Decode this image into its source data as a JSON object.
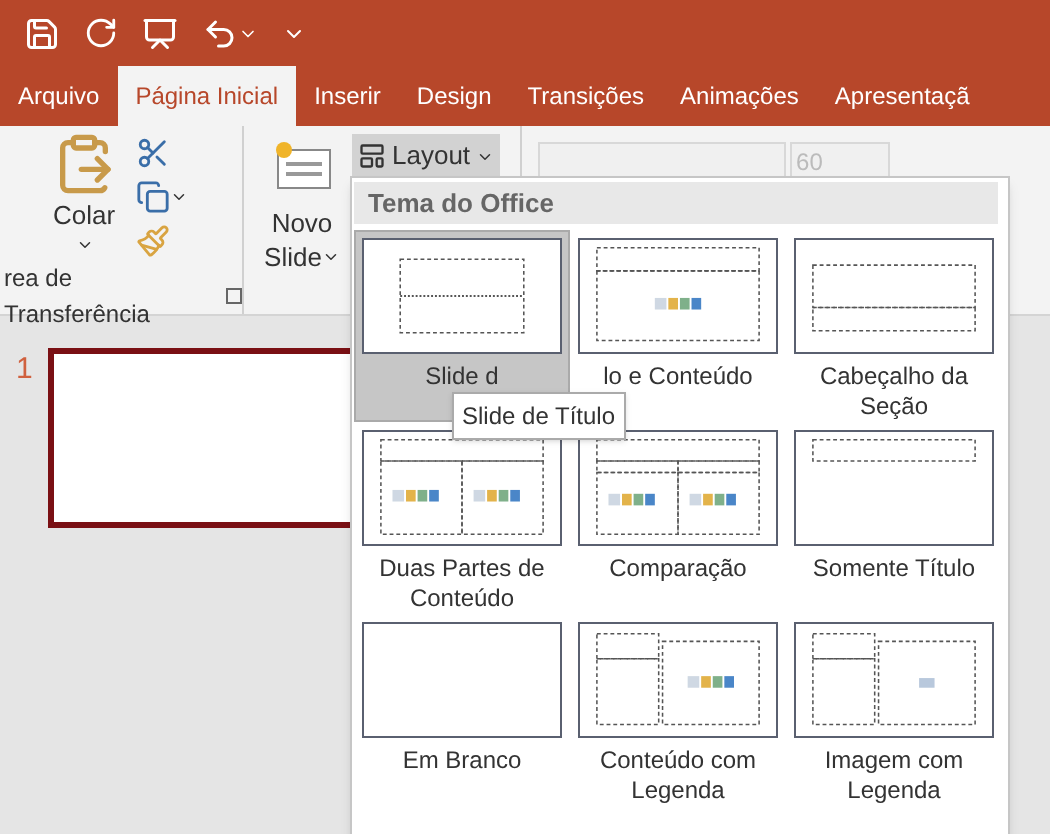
{
  "tabs": [
    {
      "label": "Arquivo",
      "selected": false
    },
    {
      "label": "Página Inicial",
      "selected": true
    },
    {
      "label": "Inserir",
      "selected": false
    },
    {
      "label": "Design",
      "selected": false
    },
    {
      "label": "Transições",
      "selected": false
    },
    {
      "label": "Animações",
      "selected": false
    },
    {
      "label": "Apresentaçã",
      "selected": false
    }
  ],
  "ribbon": {
    "paste_label": "Colar",
    "clipboard_group_label": "rea de Transferência",
    "new_slide_label": "Novo",
    "new_slide_label_2": "Slide",
    "layout_button": {
      "label": "Layout",
      "pressed": true
    },
    "font_size": "60"
  },
  "slides": [
    {
      "number": "1",
      "selected": true
    }
  ],
  "layout_menu": {
    "header": "Tema do Office",
    "tooltip": "Slide de Título",
    "items": [
      {
        "label": "Slide d",
        "kind": "title",
        "selected": true
      },
      {
        "label": "lo e Conteúdo",
        "kind": "title_content",
        "selected": false
      },
      {
        "label": "Cabeçalho da Seção",
        "kind": "section",
        "selected": false
      },
      {
        "label": "Duas Partes de Conteúdo",
        "kind": "two_content",
        "selected": false
      },
      {
        "label": "Comparação",
        "kind": "comparison",
        "selected": false
      },
      {
        "label": "Somente Título",
        "kind": "title_only",
        "selected": false
      },
      {
        "label": "Em Branco",
        "kind": "blank",
        "selected": false
      },
      {
        "label": "Conteúdo com Legenda",
        "kind": "content_caption",
        "selected": false
      },
      {
        "label": "Imagem com Legenda",
        "kind": "picture_caption",
        "selected": false
      }
    ]
  }
}
